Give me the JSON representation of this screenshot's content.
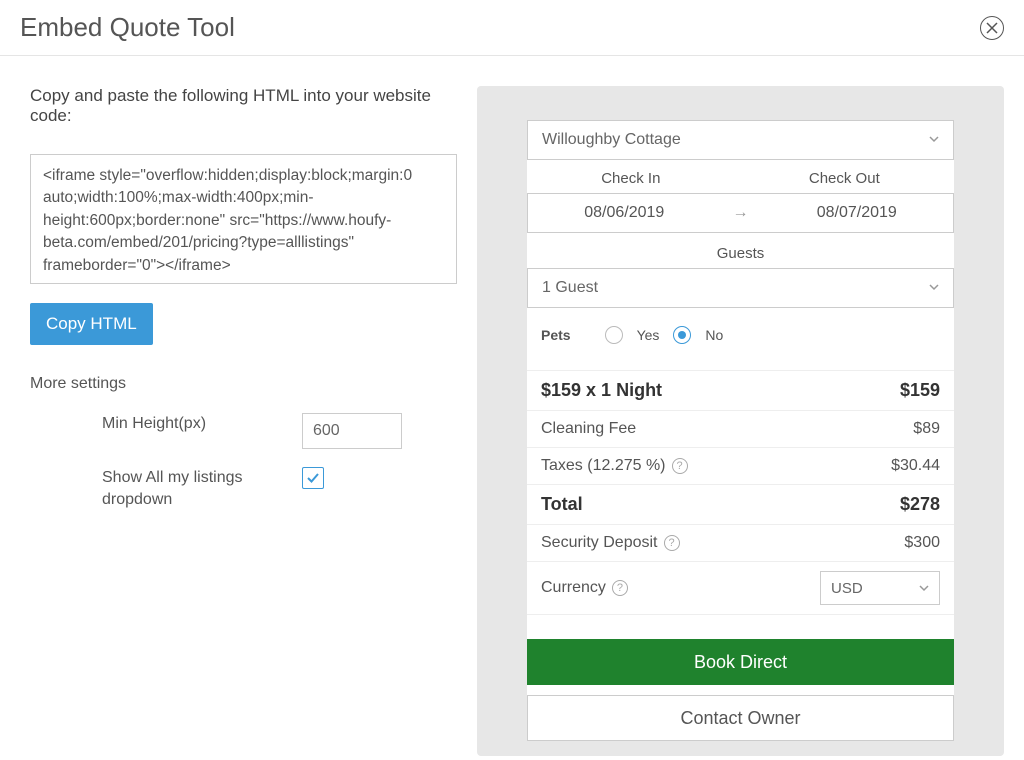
{
  "header": {
    "title": "Embed Quote Tool"
  },
  "left": {
    "desc": "Copy and paste the following HTML into your website code:",
    "code": "<iframe style=\"overflow:hidden;display:block;margin:0 auto;width:100%;max-width:400px;min-height:600px;border:none\" src=\"https://www.houfy-beta.com/embed/201/pricing?type=alllistings\" frameborder=\"0\"></iframe>",
    "copy_btn": "Copy HTML",
    "more_settings": "More settings",
    "min_height_label": "Min Height(px)",
    "min_height_value": "600",
    "show_all_label": "Show All my listings dropdown"
  },
  "widget": {
    "property": "Willoughby Cottage",
    "checkin_label": "Check In",
    "checkout_label": "Check Out",
    "checkin": "08/06/2019",
    "checkout": "08/07/2019",
    "guests_label": "Guests",
    "guests_value": "1 Guest",
    "pets_label": "Pets",
    "pets_yes": "Yes",
    "pets_no": "No",
    "rows": [
      {
        "label": "$159 x 1 Night",
        "value": "$159",
        "bold": true
      },
      {
        "label": "Cleaning Fee",
        "value": "$89"
      },
      {
        "label": "Taxes (12.275 %)",
        "value": "$30.44",
        "help": true
      },
      {
        "label": "Total",
        "value": "$278",
        "bold": true
      },
      {
        "label": "Security Deposit",
        "value": "$300",
        "help": true
      }
    ],
    "currency_label": "Currency",
    "currency_value": "USD",
    "book_btn": "Book Direct",
    "contact_btn": "Contact Owner"
  }
}
